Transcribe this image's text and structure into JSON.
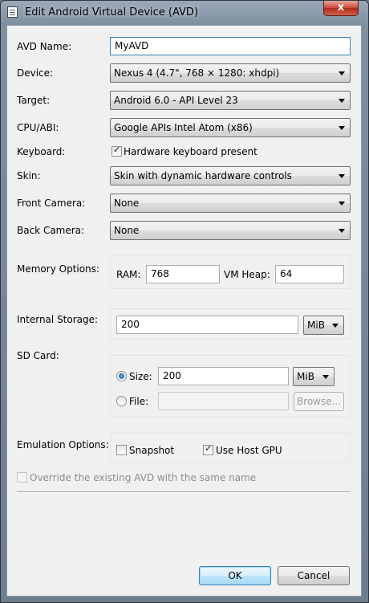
{
  "window": {
    "title": "Edit Android Virtual Device (AVD)",
    "close_glyph": "x"
  },
  "fields": {
    "avd_name": {
      "label": "AVD Name:",
      "value": "MyAVD"
    },
    "device": {
      "label": "Device:",
      "value": "Nexus 4 (4.7\", 768 × 1280: xhdpi)"
    },
    "target": {
      "label": "Target:",
      "value": "Android 6.0 - API Level 23"
    },
    "cpu_abi": {
      "label": "CPU/ABI:",
      "value": "Google APIs Intel Atom (x86)"
    },
    "keyboard": {
      "label": "Keyboard:",
      "checkbox_label": "Hardware keyboard present",
      "checked": true
    },
    "skin": {
      "label": "Skin:",
      "value": "Skin with dynamic hardware controls"
    },
    "front_camera": {
      "label": "Front Camera:",
      "value": "None"
    },
    "back_camera": {
      "label": "Back Camera:",
      "value": "None"
    }
  },
  "memory": {
    "label": "Memory Options:",
    "ram_label": "RAM:",
    "ram_value": "768",
    "vm_heap_label": "VM Heap:",
    "vm_heap_value": "64"
  },
  "internal_storage": {
    "label": "Internal Storage:",
    "value": "200",
    "unit": "MiB"
  },
  "sd_card": {
    "label": "SD Card:",
    "size_label": "Size:",
    "size_value": "200",
    "size_unit": "MiB",
    "size_selected": true,
    "file_label": "File:",
    "file_value": "",
    "browse_label": "Browse..."
  },
  "emulation": {
    "label": "Emulation Options:",
    "snapshot_label": "Snapshot",
    "snapshot_checked": false,
    "host_gpu_label": "Use Host GPU",
    "host_gpu_checked": true
  },
  "override": {
    "label": "Override the existing AVD with the same name",
    "checked": false
  },
  "buttons": {
    "ok": "OK",
    "cancel": "Cancel"
  },
  "check_glyph": "✓"
}
